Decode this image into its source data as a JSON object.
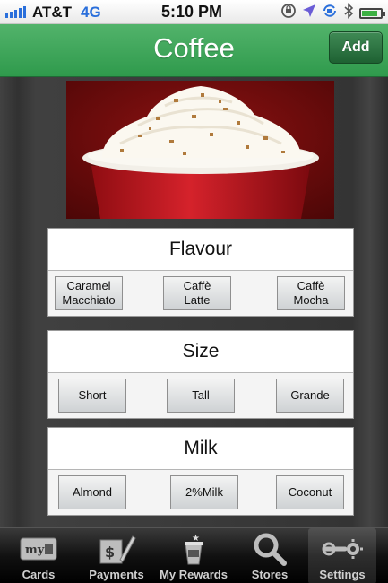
{
  "status_bar": {
    "carrier": "AT&T",
    "network": "4G",
    "time": "5:10 PM",
    "icons": [
      "rotation-lock-icon",
      "location-arrow-icon",
      "sync-icon",
      "bluetooth-icon",
      "battery-icon"
    ],
    "battery_level": 0.85
  },
  "navbar": {
    "title": "Coffee",
    "add_label": "Add",
    "color": "#3aa457"
  },
  "product": {
    "image_description_icon": "coffee-cup-photo"
  },
  "sections": [
    {
      "title": "Flavour",
      "options": [
        {
          "line1": "Caramel",
          "line2": "Macchiato"
        },
        {
          "line1": "Caffè",
          "line2": "Latte"
        },
        {
          "line1": "Caffè",
          "line2": "Mocha"
        }
      ]
    },
    {
      "title": "Size",
      "options": [
        {
          "line1": "Short"
        },
        {
          "line1": "Tall"
        },
        {
          "line1": "Grande"
        }
      ]
    },
    {
      "title": "Milk",
      "options": [
        {
          "line1": "Almond"
        },
        {
          "line1": "2%Milk"
        },
        {
          "line1": "Coconut"
        }
      ]
    }
  ],
  "tabbar": {
    "tabs": [
      {
        "label": "Cards",
        "icon": "card-icon"
      },
      {
        "label": "Payments",
        "icon": "payments-icon"
      },
      {
        "label": "My Rewards",
        "icon": "rewards-cup-icon"
      },
      {
        "label": "Stores",
        "icon": "search-icon"
      },
      {
        "label": "Settings",
        "icon": "wrench-gear-icon"
      }
    ],
    "selected": "Settings"
  }
}
